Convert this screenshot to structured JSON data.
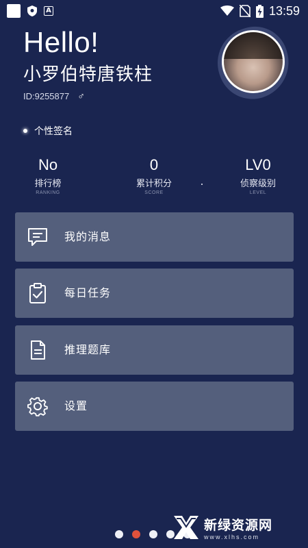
{
  "status_bar": {
    "time": "13:59",
    "left_icons": [
      "app-square-icon",
      "shield-icon",
      "a-badge-icon"
    ],
    "right_icons": [
      "wifi-icon",
      "no-sim-icon",
      "battery-charging-icon"
    ],
    "a_badge_text": "A"
  },
  "profile": {
    "greeting": "Hello!",
    "username": "小罗伯特唐铁柱",
    "id_text": "ID:9255877",
    "gender_symbol": "♂",
    "signature": "个性签名"
  },
  "stats": [
    {
      "value": "No",
      "label": "排行榜",
      "sub": "RANKING"
    },
    {
      "value": "0",
      "label": "累计积分",
      "sub": "SCORE"
    },
    {
      "value": "LV0",
      "label": "侦察级别",
      "sub": "LEVEL"
    }
  ],
  "menu": [
    {
      "label": "我的消息",
      "icon": "message-icon"
    },
    {
      "label": "每日任务",
      "icon": "clipboard-check-icon"
    },
    {
      "label": "推理题库",
      "icon": "document-icon"
    },
    {
      "label": "设置",
      "icon": "gear-icon"
    }
  ],
  "pager": {
    "count": 5,
    "active_index": 1
  },
  "watermark": {
    "brand": "新绿资源网",
    "url": "www.xlhs.com"
  },
  "colors": {
    "background": "#1a2550",
    "card": "#545f7c",
    "active_dot": "#e0523c"
  }
}
